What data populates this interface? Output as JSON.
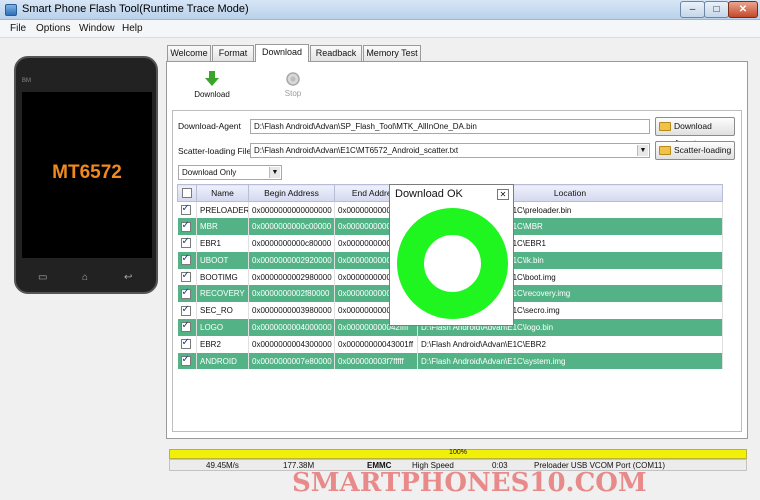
{
  "window": {
    "title": "Smart Phone Flash Tool(Runtime Trace Mode)",
    "min": "–",
    "max": "□",
    "close": "✕"
  },
  "menu": [
    "File",
    "Options",
    "Window",
    "Help"
  ],
  "phone": {
    "brand": "BM",
    "chip": "MT6572",
    "menu_icon": "▭",
    "home_icon": "⌂",
    "back_icon": "↩"
  },
  "tabs": [
    "Welcome",
    "Format",
    "Download",
    "Readback",
    "Memory Test"
  ],
  "toolbar": {
    "download_label": "Download",
    "stop_label": "Stop"
  },
  "download_agent": {
    "label": "Download-Agent",
    "value": "D:\\Flash Android\\Advan\\SP_Flash_Tool\\MTK_AllInOne_DA.bin",
    "button": "Download Agent"
  },
  "scatter": {
    "label": "Scatter-loading File",
    "value": "D:\\Flash Android\\Advan\\E1C\\MT6572_Android_scatter.txt",
    "button": "Scatter-loading"
  },
  "mode_select": {
    "value": "Download Only"
  },
  "table": {
    "headers": [
      "Name",
      "Begin Address",
      "End Address",
      "Location"
    ],
    "rows": [
      {
        "name": "PRELOADER",
        "begin": "0x0000000000000000",
        "end": "0x0000000000...",
        "location": "D:\\Flash Android\\Advan\\E1C\\preloader.bin"
      },
      {
        "name": "MBR",
        "begin": "0x0000000000c00000",
        "end": "0x0000000000...",
        "location": "D:\\Flash Android\\Advan\\E1C\\MBR"
      },
      {
        "name": "EBR1",
        "begin": "0x0000000000c80000",
        "end": "0x0000000000...",
        "location": "D:\\Flash Android\\Advan\\E1C\\EBR1"
      },
      {
        "name": "UBOOT",
        "begin": "0x0000000002920000",
        "end": "0x0000000000...",
        "location": "D:\\Flash Android\\Advan\\E1C\\lk.bin"
      },
      {
        "name": "BOOTIMG",
        "begin": "0x0000000002980000",
        "end": "0x0000000000...",
        "location": "D:\\Flash Android\\Advan\\E1C\\boot.img"
      },
      {
        "name": "RECOVERY",
        "begin": "0x0000000002f80000",
        "end": "0x0000000000...",
        "location": "D:\\Flash Android\\Advan\\E1C\\recovery.img"
      },
      {
        "name": "SEC_RO",
        "begin": "0x0000000003980000",
        "end": "0x0000000000...",
        "location": "D:\\Flash Android\\Advan\\E1C\\secro.img"
      },
      {
        "name": "LOGO",
        "begin": "0x0000000004000000",
        "end": "0x000000000042ffff",
        "location": "D:\\Flash Android\\Advan\\E1C\\logo.bin"
      },
      {
        "name": "EBR2",
        "begin": "0x0000000004300000",
        "end": "0x00000000043001ff",
        "location": "D:\\Flash Android\\Advan\\E1C\\EBR2"
      },
      {
        "name": "ANDROID",
        "begin": "0x0000000007e80000",
        "end": "0x000000003f7fffff",
        "location": "D:\\Flash Android\\Advan\\E1C\\system.img"
      }
    ]
  },
  "popup": {
    "title": "Download OK",
    "close": "✕",
    "ring_color": "#1ff51f"
  },
  "progress": {
    "text": "100%",
    "fraction": 1.0
  },
  "status": {
    "speed": "49.45M/s",
    "size": "177.38M",
    "storage": "EMMC",
    "usb": "High Speed",
    "time": "0:03",
    "port": "Preloader USB VCOM Port (COM11)"
  },
  "watermark": "SMARTPHONES10.COM",
  "colors": {
    "row_green": "#54b386",
    "progress_yellow": "#f2ef08",
    "chip_orange": "#f08a1c"
  }
}
